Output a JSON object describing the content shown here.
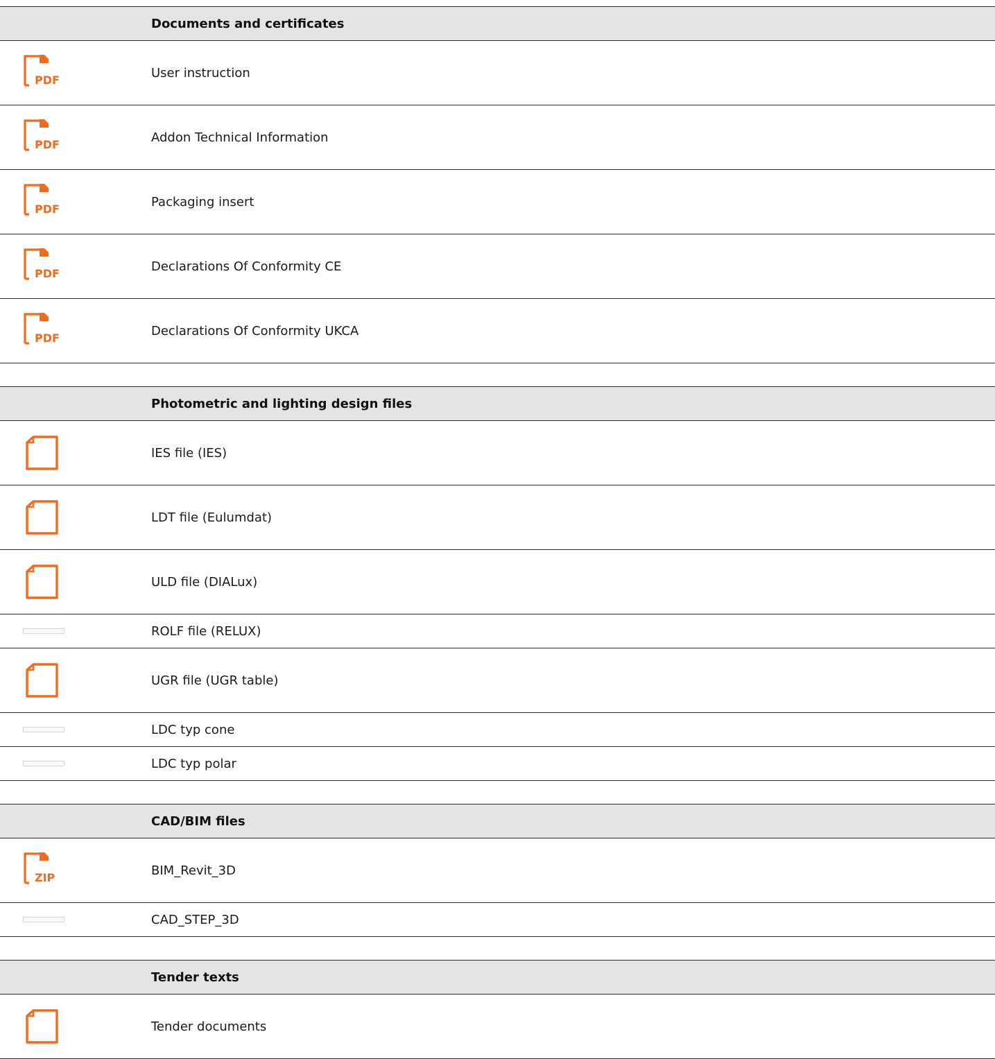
{
  "sections": [
    {
      "title": "Documents and certificates",
      "items": [
        {
          "label": "User instruction",
          "icon": "pdf-icon"
        },
        {
          "label": "Addon Technical Information",
          "icon": "pdf-icon"
        },
        {
          "label": "Packaging insert",
          "icon": "pdf-icon"
        },
        {
          "label": "Declarations Of Conformity CE",
          "icon": "pdf-icon"
        },
        {
          "label": "Declarations Of Conformity UKCA",
          "icon": "pdf-icon"
        }
      ]
    },
    {
      "title": "Photometric and lighting design files",
      "items": [
        {
          "label": "IES file (IES)",
          "icon": "file-icon"
        },
        {
          "label": "LDT file (Eulumdat)",
          "icon": "file-icon"
        },
        {
          "label": "ULD file (DIALux)",
          "icon": "file-icon"
        },
        {
          "label": "ROLF file (RELUX)",
          "icon": "placeholder"
        },
        {
          "label": "UGR file (UGR table)",
          "icon": "file-icon"
        },
        {
          "label": "LDC typ cone",
          "icon": "placeholder"
        },
        {
          "label": "LDC typ polar",
          "icon": "placeholder"
        }
      ]
    },
    {
      "title": "CAD/BIM files",
      "items": [
        {
          "label": "BIM_Revit_3D",
          "icon": "zip-icon"
        },
        {
          "label": "CAD_STEP_3D",
          "icon": "placeholder"
        }
      ]
    },
    {
      "title": "Tender texts",
      "items": [
        {
          "label": "Tender documents",
          "icon": "file-icon"
        }
      ]
    }
  ],
  "icon_text": {
    "pdf": "PDF",
    "zip": "ZIP"
  },
  "colors": {
    "accent": "#f26b1d",
    "header_bg": "#e4e4e4",
    "rule": "#2a2a2a"
  }
}
